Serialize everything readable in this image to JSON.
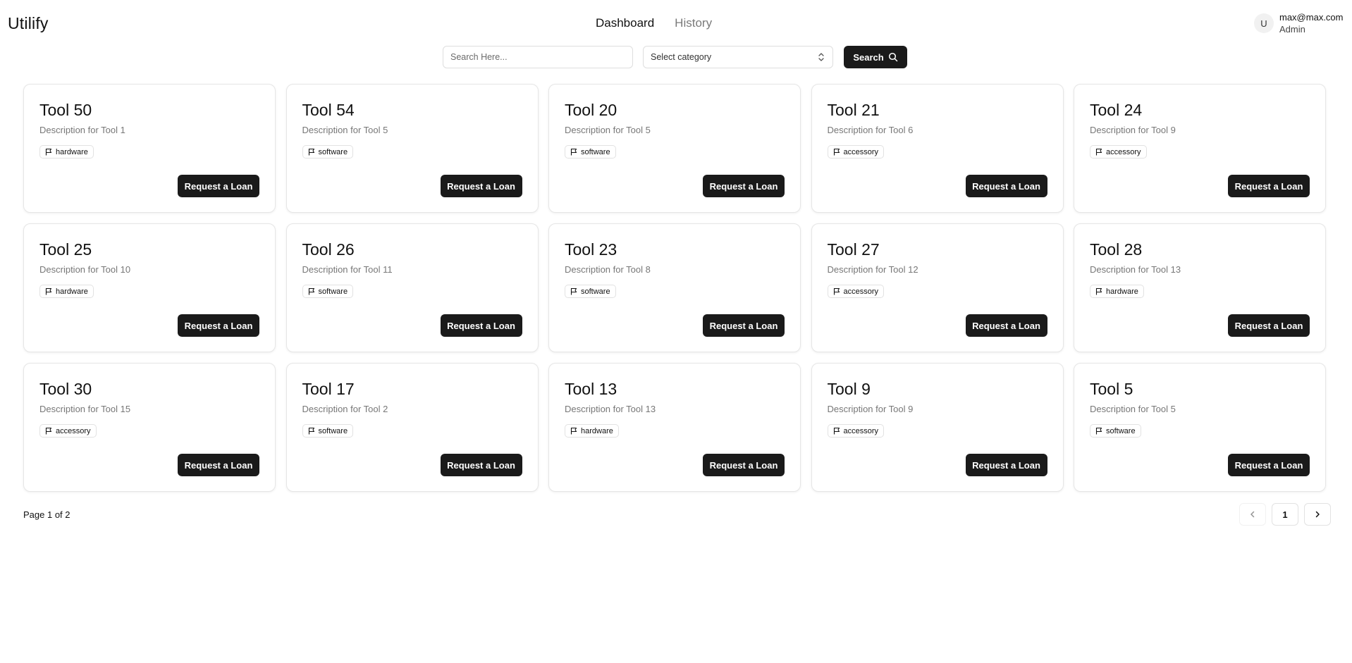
{
  "header": {
    "logo": "Utilify",
    "nav": [
      {
        "label": "Dashboard",
        "active": true
      },
      {
        "label": "History",
        "active": false
      }
    ],
    "user": {
      "avatar_initial": "U",
      "email": "max@max.com",
      "role": "Admin"
    }
  },
  "search": {
    "placeholder": "Search Here...",
    "value": "",
    "category_placeholder": "Select category",
    "button_label": "Search",
    "button_icon": "search-icon"
  },
  "tools": [
    {
      "title": "Tool 50",
      "description": "Description for Tool 1",
      "category": "hardware",
      "action": "Request a Loan"
    },
    {
      "title": "Tool 54",
      "description": "Description for Tool 5",
      "category": "software",
      "action": "Request a Loan"
    },
    {
      "title": "Tool 20",
      "description": "Description for Tool 5",
      "category": "software",
      "action": "Request a Loan"
    },
    {
      "title": "Tool 21",
      "description": "Description for Tool 6",
      "category": "accessory",
      "action": "Request a Loan"
    },
    {
      "title": "Tool 24",
      "description": "Description for Tool 9",
      "category": "accessory",
      "action": "Request a Loan"
    },
    {
      "title": "Tool 25",
      "description": "Description for Tool 10",
      "category": "hardware",
      "action": "Request a Loan"
    },
    {
      "title": "Tool 26",
      "description": "Description for Tool 11",
      "category": "software",
      "action": "Request a Loan"
    },
    {
      "title": "Tool 23",
      "description": "Description for Tool 8",
      "category": "software",
      "action": "Request a Loan"
    },
    {
      "title": "Tool 27",
      "description": "Description for Tool 12",
      "category": "accessory",
      "action": "Request a Loan"
    },
    {
      "title": "Tool 28",
      "description": "Description for Tool 13",
      "category": "hardware",
      "action": "Request a Loan"
    },
    {
      "title": "Tool 30",
      "description": "Description for Tool 15",
      "category": "accessory",
      "action": "Request a Loan"
    },
    {
      "title": "Tool 17",
      "description": "Description for Tool 2",
      "category": "software",
      "action": "Request a Loan"
    },
    {
      "title": "Tool 13",
      "description": "Description for Tool 13",
      "category": "hardware",
      "action": "Request a Loan"
    },
    {
      "title": "Tool 9",
      "description": "Description for Tool 9",
      "category": "accessory",
      "action": "Request a Loan"
    },
    {
      "title": "Tool 5",
      "description": "Description for Tool 5",
      "category": "software",
      "action": "Request a Loan"
    }
  ],
  "badge_icon": "flag-icon",
  "pagination": {
    "summary": "Page 1 of 2",
    "current_page": "1",
    "prev_icon": "chevron-left-icon",
    "next_icon": "chevron-right-icon"
  },
  "colors": {
    "primary_button": "#1a1a1a",
    "muted_text": "#777777",
    "border": "#e6e6e6"
  }
}
